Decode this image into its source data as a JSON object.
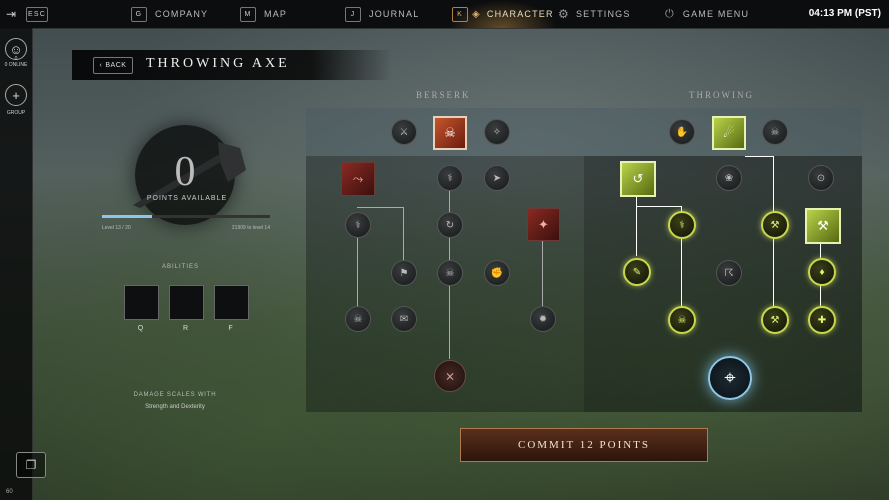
{
  "topbar": {
    "esc": {
      "key": "ESC"
    },
    "items": [
      {
        "key": "G",
        "label": "COMPANY"
      },
      {
        "key": "M",
        "label": "MAP"
      },
      {
        "key": "J",
        "label": "JOURNAL"
      },
      {
        "key": "K",
        "label": "CHARACTER"
      },
      {
        "key": "",
        "label": "SETTINGS"
      },
      {
        "key": "",
        "label": "GAME MENU"
      }
    ],
    "clock": "04:13 PM (PST)"
  },
  "leftrail": {
    "online_label": "0 ONLINE",
    "online_count": "0",
    "group_label": "GROUP",
    "pop": "60"
  },
  "header": {
    "back_label": "BACK",
    "title": "THROWING AXE"
  },
  "points": {
    "value": "0",
    "label": "POINTS AVAILABLE",
    "level_text": "Level 13 / 20",
    "xp_text": "21909 to level 14",
    "xp_fraction": 0.3
  },
  "abilities": {
    "title": "ABILITIES",
    "slots": [
      "Q",
      "R",
      "F"
    ]
  },
  "damage": {
    "title": "DAMAGE SCALES WITH",
    "stats": "Strength and Dexterity"
  },
  "trees": {
    "left_title": "BERSERK",
    "right_title": "THROWING"
  },
  "commit": {
    "label": "COMMIT 12 POINTS"
  },
  "colors": {
    "accent_active": "#b08040",
    "node_lit": "#c8d84a",
    "commit_bg": "#4a2616",
    "xp_fill": "#8ec5ee"
  }
}
